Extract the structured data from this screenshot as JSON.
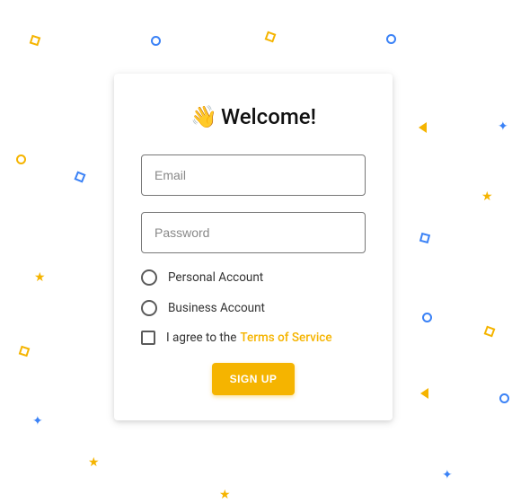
{
  "title": {
    "emoji": "👋",
    "text": "Welcome!"
  },
  "fields": {
    "email": {
      "placeholder": "Email",
      "value": ""
    },
    "password": {
      "placeholder": "Password",
      "value": ""
    }
  },
  "options": {
    "personal": "Personal Account",
    "business": "Business Account"
  },
  "terms": {
    "prefix": "I agree to the",
    "link": "Terms of Service"
  },
  "button": {
    "signup": "SIGN UP"
  },
  "colors": {
    "accent": "#f5b400",
    "confetti_blue": "#3b82f6",
    "confetti_yellow": "#f5b400"
  }
}
